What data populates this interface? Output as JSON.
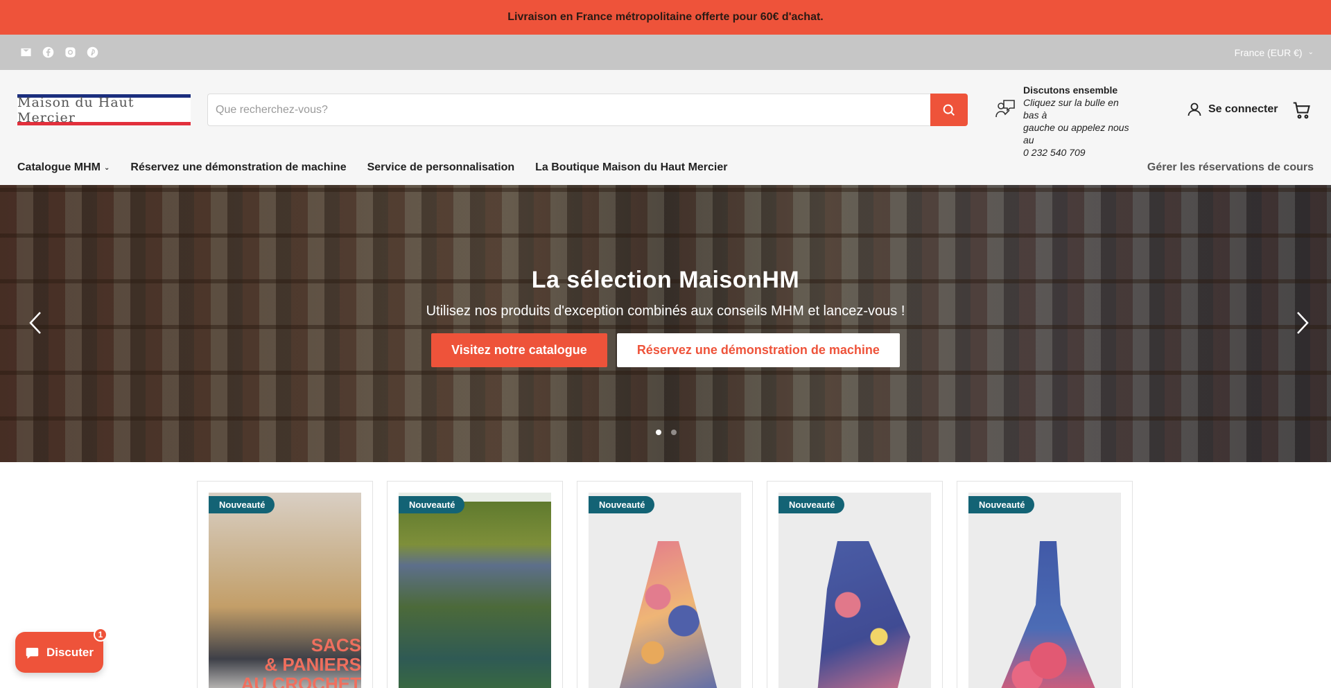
{
  "announcement": {
    "text": "Livraison en France métropolitaine offerte pour 60€ d'achat."
  },
  "utility": {
    "socials": [
      "mail-icon",
      "facebook-icon",
      "instagram-icon",
      "pinterest-icon"
    ],
    "country": "France (EUR €)"
  },
  "header": {
    "logo_text": "Maison du Haut Mercier",
    "search": {
      "placeholder": "Que recherchez-vous?",
      "value": ""
    },
    "contact": {
      "title": "Discutons ensemble",
      "line1": "Cliquez sur la bulle en bas à",
      "line2": "gauche ou appelez nous au",
      "line3": "0 232 540 709"
    },
    "login_label": "Se connecter"
  },
  "nav": {
    "items": [
      {
        "label": "Catalogue MHM",
        "has_dropdown": true
      },
      {
        "label": "Réservez une démonstration de machine"
      },
      {
        "label": "Service de personnalisation"
      },
      {
        "label": "La Boutique Maison du Haut Mercier"
      }
    ],
    "right_label": "Gérer les réservations de cours"
  },
  "hero": {
    "title": "La sélection MaisonHM",
    "subtitle": "Utilisez nos produits d'exception combinés aux conseils MHM et lancez-vous !",
    "cta_primary": "Visitez notre catalogue",
    "cta_secondary": "Réservez une démonstration de machine",
    "slide_count": 2,
    "active_slide": 1
  },
  "products": [
    {
      "badge": "Nouveauté",
      "image": "bag-book-cover",
      "overlay_line1": "SACS",
      "overlay_line2": "& PANIERS",
      "overlay_line3": "AU CROCHET"
    },
    {
      "badge": "Nouveauté",
      "image": "monet-bridge-embroidery"
    },
    {
      "badge": "Nouveauté",
      "image": "floral-dress-embroidery"
    },
    {
      "badge": "Nouveauté",
      "image": "floral-dress-embroidery-2"
    },
    {
      "badge": "Nouveauté",
      "image": "floral-dress-embroidery-3"
    }
  ],
  "chat": {
    "label": "Discuter",
    "unread": "1"
  },
  "colors": {
    "accent": "#ee533a",
    "badge": "#136375",
    "utility_bar": "#c6c6c6"
  }
}
